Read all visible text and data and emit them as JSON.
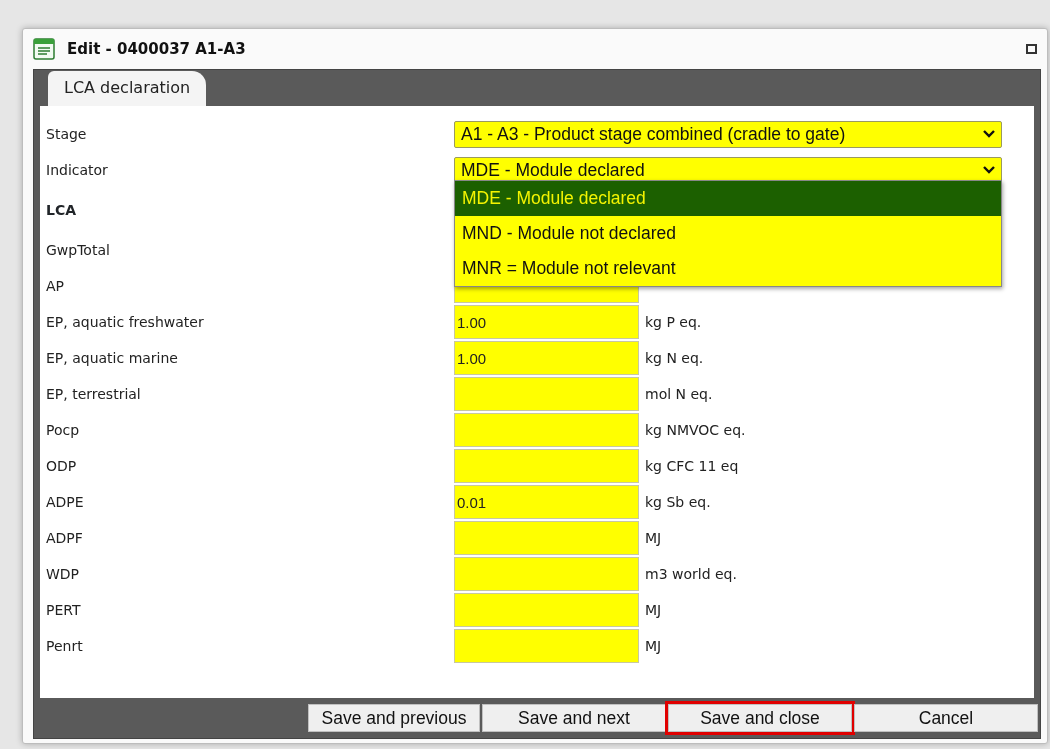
{
  "window": {
    "title": "Edit - 0400037 A1-A3"
  },
  "tabs": [
    {
      "label": "LCA declaration",
      "selected": true
    }
  ],
  "stage": {
    "label": "Stage",
    "value": "A1 - A3 - Product stage combined (cradle to gate)"
  },
  "indicator": {
    "label": "Indicator",
    "value": "MDE - Module declared",
    "expanded": true,
    "options": [
      {
        "label": "MDE - Module declared",
        "selected": true
      },
      {
        "label": "MND - Module not declared",
        "selected": false
      },
      {
        "label": "MNR = Module not relevant",
        "selected": false
      }
    ]
  },
  "section": {
    "title": "LCA"
  },
  "rows": [
    {
      "label": "GwpTotal"
    },
    {
      "label": "AP"
    },
    {
      "label": "EP, aquatic freshwater",
      "value": "1.00",
      "unit": "kg P eq."
    },
    {
      "label": "EP, aquatic marine",
      "value": "1.00",
      "unit": "kg N eq."
    },
    {
      "label": "EP, terrestrial",
      "unit": "mol N eq."
    },
    {
      "label": "Pocp",
      "unit": "kg NMVOC eq."
    },
    {
      "label": "ODP",
      "unit": "kg CFC 11 eq"
    },
    {
      "label": "ADPE",
      "value": "0.01",
      "unit": "kg Sb eq."
    },
    {
      "label": "ADPF",
      "unit": "MJ"
    },
    {
      "label": "WDP",
      "unit": "m3 world eq."
    },
    {
      "label": "PERT",
      "unit": "MJ"
    },
    {
      "label": "Penrt",
      "unit": "MJ"
    }
  ],
  "buttons": [
    {
      "label": "Save and previous",
      "highlighted": false
    },
    {
      "label": "Save and next",
      "highlighted": false
    },
    {
      "label": "Save and close",
      "highlighted": true
    },
    {
      "label": "Cancel",
      "highlighted": false
    }
  ]
}
